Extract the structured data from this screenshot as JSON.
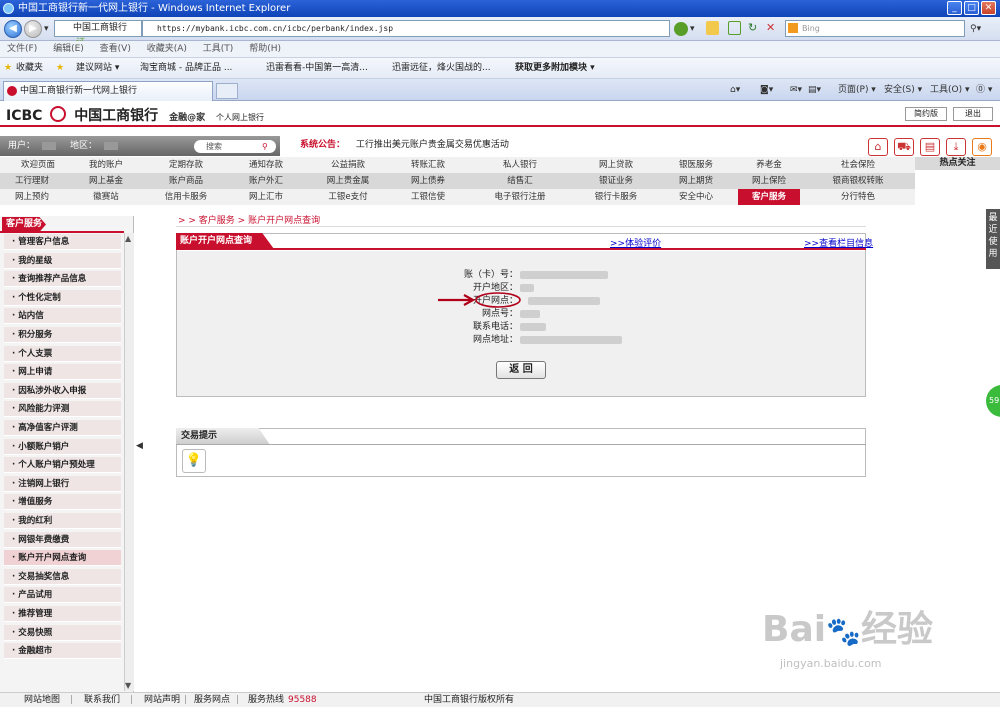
{
  "window": {
    "title": "中国工商银行新一代网上银行 - Windows Internet Explorer"
  },
  "addressbar": {
    "site_label": "中国工商银行",
    "cert": "证",
    "url": "https://mybank.icbc.com.cn/icbc/perbank/index.jsp",
    "search_placeholder": "Bing"
  },
  "menubar": {
    "items": [
      "文件(F)",
      "编辑(E)",
      "查看(V)",
      "收藏夹(A)",
      "工具(T)",
      "帮助(H)"
    ]
  },
  "favorites": {
    "label": "收藏夹",
    "items": [
      "建议网站 ▾",
      "淘宝商城 - 品牌正品 ...",
      "迅雷看看-中国第一高清...",
      "迅雷远征，烽火国战的...",
      "获取更多附加模块 ▾"
    ]
  },
  "tab": {
    "label": "中国工商银行新一代网上银行",
    "page_menu": "页面(P) ▾",
    "safety_menu": "安全(S) ▾",
    "tools_menu": "工具(O) ▾",
    "help_menu": "⓪ ▾"
  },
  "header": {
    "logo_en": "ICBC",
    "logo_cn": "中国工商银行",
    "slogan": "金融@家",
    "subtitle": "个人网上银行",
    "simple_btn": "简约版",
    "logout_btn": "退出"
  },
  "userbar": {
    "user_label": "用户：",
    "region_label": "地区：",
    "search_placeholder": "搜索"
  },
  "notice": {
    "label": "系统公告：",
    "text": "工行推出美元账户贵金属交易优惠活动"
  },
  "nav": {
    "row1": [
      "欢迎页面",
      "我的账户",
      "定期存款",
      "通知存款",
      "公益捐款",
      "转账汇款",
      "私人银行",
      "网上贷款",
      "银医服务",
      "养老金",
      "社会保险"
    ],
    "row2": [
      "工行理财",
      "网上基金",
      "账户商品",
      "账户外汇",
      "网上贵金属",
      "网上债券",
      "结售汇",
      "银证业务",
      "网上期货",
      "网上保险",
      "银商银权转账"
    ],
    "row3": [
      "网上预约",
      "徽赛站",
      "信用卡服务",
      "网上汇市",
      "工银e支付",
      "工银信使",
      "电子银行注册",
      "银行卡服务",
      "安全中心",
      "客户服务",
      "分行特色"
    ],
    "hot": "热点关注"
  },
  "sidebar": {
    "title": "客户服务",
    "items": [
      "管理客户信息",
      "我的星级",
      "查询推荐产品信息",
      "个性化定制",
      "站内信",
      "积分服务",
      "个人支票",
      "网上申请",
      "因私涉外收入申报",
      "风险能力评测",
      "高净值客户评测",
      "小额账户销户",
      "个人账户销户预处理",
      "注销网上银行",
      "增值服务",
      "我的红利",
      "网银年费缴费",
      "账户开户网点查询",
      "交易抽奖信息",
      "产品试用",
      "推荐管理",
      "交易快照",
      "金融超市"
    ],
    "selected_index": 17
  },
  "breadcrumb": "> > 客户服务 > 账户开户网点查询",
  "query": {
    "title": "账户开户网点查询",
    "experience_link": ">>体验评价",
    "column_link": ">>查看栏目信息",
    "fields": [
      {
        "label": "账（卡）号："
      },
      {
        "label": "开户地区："
      },
      {
        "label": "开户网点："
      },
      {
        "label": "网点号："
      },
      {
        "label": "联系电话："
      },
      {
        "label": "网点地址："
      }
    ],
    "back_btn": "返 回"
  },
  "tips": {
    "title": "交易提示"
  },
  "side_tabs": {
    "recent": "最近使用",
    "green_badge": "59"
  },
  "footer": {
    "items": [
      "网站地图",
      "联系我们",
      "网站声明",
      "服务网点",
      "服务热线"
    ],
    "hotline": "95588",
    "org": "中国工商银行版权所有"
  },
  "watermark": {
    "text": "Bai 经验",
    "url": "jingyan.baidu.com"
  }
}
